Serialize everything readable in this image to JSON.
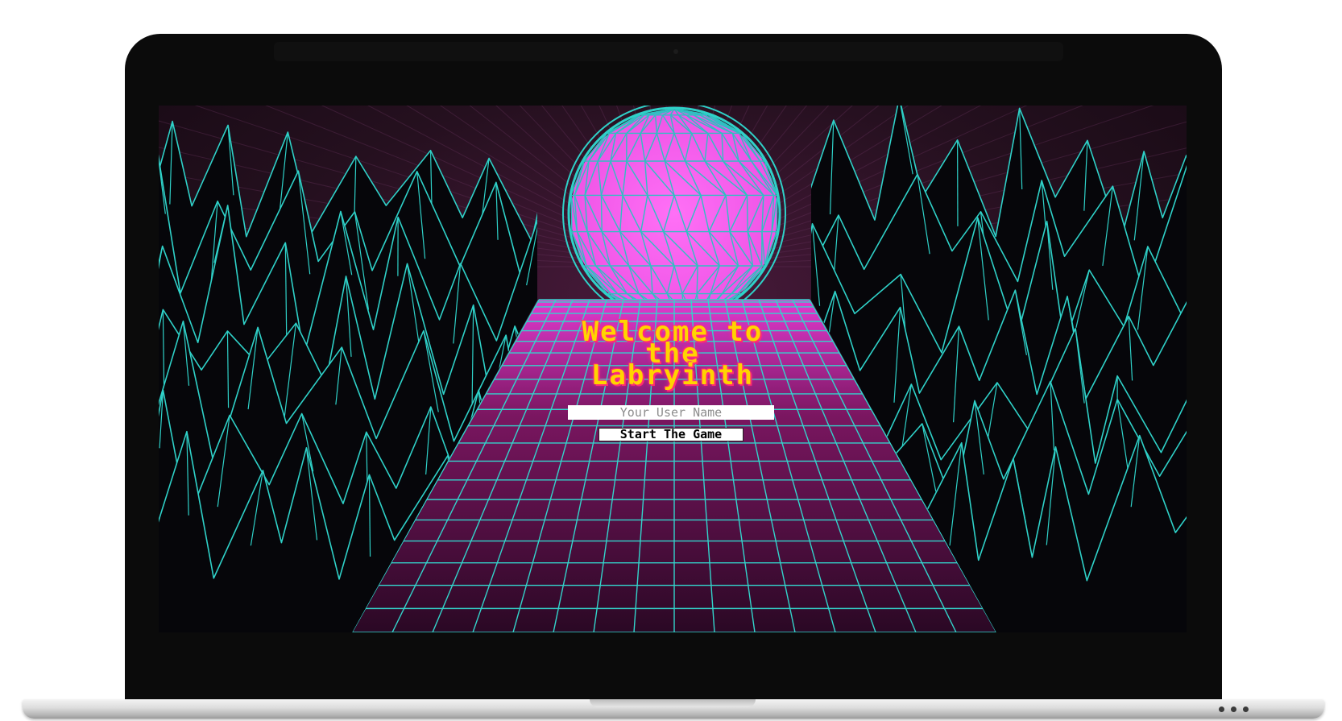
{
  "welcome": {
    "line1": "Welcome to",
    "line2": "the",
    "line3": "Labryinth"
  },
  "login": {
    "username_placeholder": "Your User Name",
    "start_label": "Start The Game"
  },
  "colors": {
    "neon_cyan": "#2fd1c8",
    "sun_pink": "#f55ff0",
    "title_yellow": "#ffd400",
    "title_glow": "#ff2d6d",
    "laptop_bezel": "#0b0b0b"
  }
}
